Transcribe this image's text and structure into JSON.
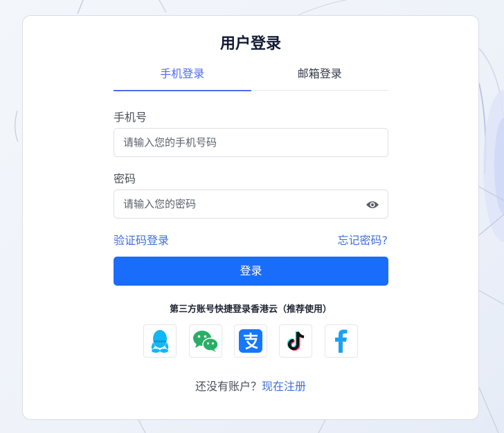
{
  "login": {
    "title": "用户登录",
    "tabs": [
      {
        "label": "手机登录",
        "active": true
      },
      {
        "label": "邮箱登录",
        "active": false
      }
    ],
    "phone_label": "手机号",
    "phone_placeholder": "请输入您的手机号码",
    "password_label": "密码",
    "password_placeholder": "请输入您的密码",
    "sms_login_link": "验证码登录",
    "forgot_password_link": "忘记密码?",
    "submit_label": "登录",
    "third_party_title": "第三方账号快捷登录香港云（推荐使用）",
    "social_icons": [
      "qq-icon",
      "wechat-icon",
      "alipay-icon",
      "tiktok-icon",
      "facebook-icon"
    ],
    "register_prompt": "还没有账户？",
    "register_link": "现在注册"
  },
  "colors": {
    "accent": "#4f6bf0",
    "primary_button": "#1a6dfa",
    "link": "#3d6fd8",
    "qq": "#12b7f5",
    "wechat": "#2aae67",
    "alipay": "#1677ff",
    "facebook": "#1da1f2"
  }
}
